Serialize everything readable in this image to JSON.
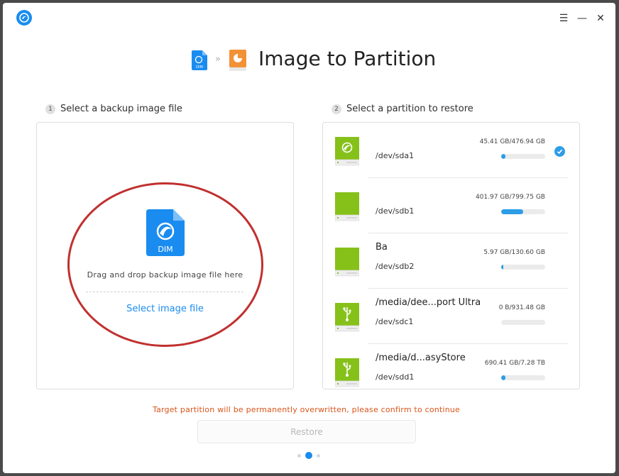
{
  "header": {
    "title": "Image to Partition",
    "dim_label": "DIM"
  },
  "steps": [
    {
      "num": "1",
      "label": "Select a backup image file"
    },
    {
      "num": "2",
      "label": "Select a partition to restore"
    }
  ],
  "left_panel": {
    "file_label": "DIM",
    "drag_text": "Drag and drop backup image file here",
    "select_link": "Select image file"
  },
  "partitions": [
    {
      "name": "",
      "device": "/dev/sda1",
      "size": "45.41 GB/476.94 GB",
      "usage": 0.095,
      "selected": true,
      "icon": "deepin-drive-icon"
    },
    {
      "name": "",
      "device": "/dev/sdb1",
      "size": "401.97 GB/799.75 GB",
      "usage": 0.5,
      "selected": false,
      "icon": "green-drive-icon"
    },
    {
      "name": "Ba",
      "device": "/dev/sdb2",
      "size": "5.97 GB/130.60 GB",
      "usage": 0.046,
      "selected": false,
      "icon": "green-drive-icon"
    },
    {
      "name": "/media/dee...port Ultra",
      "device": "/dev/sdc1",
      "size": "0 B/931.48 GB",
      "usage": 0.0,
      "selected": false,
      "icon": "usb-drive-icon"
    },
    {
      "name": "/media/d...asyStore",
      "device": "/dev/sdd1",
      "size": "690.41 GB/7.28 TB",
      "usage": 0.093,
      "selected": false,
      "icon": "usb-drive-icon"
    }
  ],
  "footer": {
    "warning": "Target partition will be permanently overwritten, please confirm to continue",
    "restore_label": "Restore"
  },
  "colors": {
    "accent": "#1a8cf0",
    "warning": "#d9551a",
    "annotation": "#c0302f",
    "drive_green": "#86c11a"
  },
  "pagination": {
    "current": 2,
    "total": 3
  }
}
